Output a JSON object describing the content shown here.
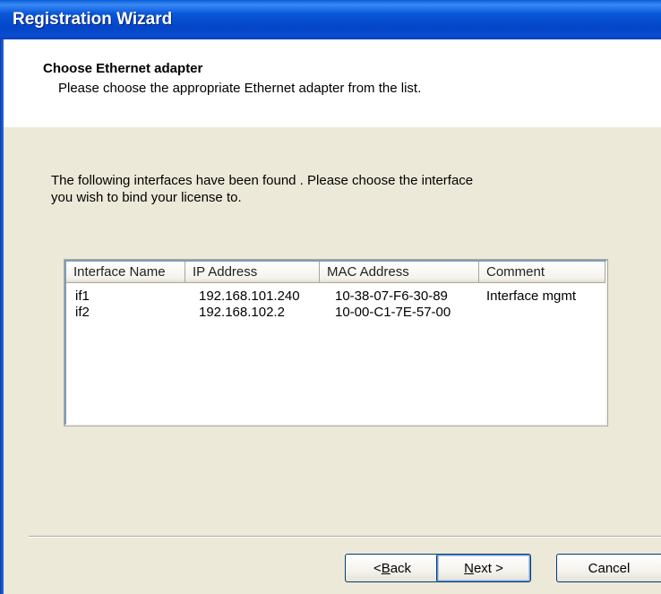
{
  "window": {
    "title": "Registration Wizard"
  },
  "header": {
    "title": "Choose Ethernet adapter",
    "subtitle": "Please choose the appropriate Ethernet adapter from the list."
  },
  "intro": {
    "line1": "The following interfaces have been found . Please choose the interface",
    "line2": "you wish to bind your license to."
  },
  "interfaces": {
    "columns": [
      "Interface Name",
      "IP Address",
      "MAC Address",
      "Comment"
    ],
    "rows": [
      [
        "if1",
        "192.168.101.240",
        "10-38-07-F6-30-89",
        "Interface mgmt"
      ],
      [
        "if2",
        "192.168.102.2",
        "10-00-C1-7E-57-00",
        ""
      ]
    ]
  },
  "buttons": {
    "back_prefix": "< ",
    "back_mnemonic": "B",
    "back_rest": "ack",
    "next_mnemonic": "N",
    "next_rest": "ext >",
    "cancel": "Cancel"
  },
  "colors": {
    "titlebar": "#0446c7",
    "dialog_bg": "#ece9d8",
    "header_bg": "#ffffff"
  }
}
